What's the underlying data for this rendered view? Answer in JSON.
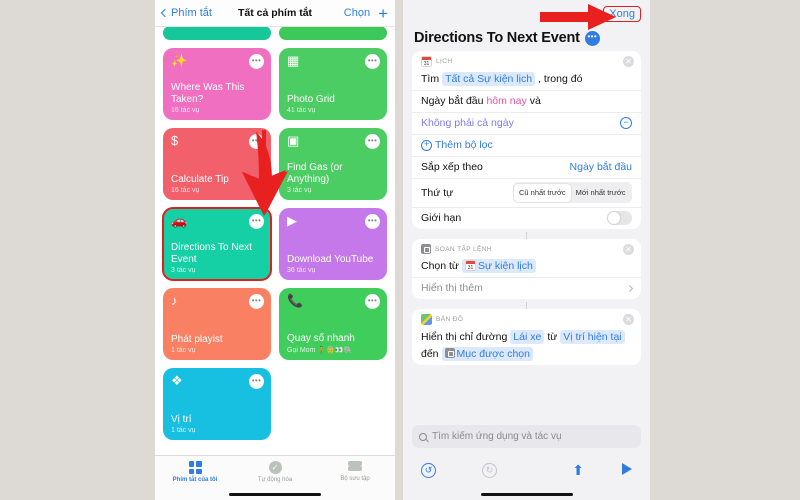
{
  "left_panel": {
    "nav": {
      "back_label": "Phím tắt",
      "title": "Tất cả phím tắt",
      "choose_label": "Chọn",
      "add_label": "+"
    },
    "cards": [
      {
        "title": "",
        "subtitle": "",
        "icon": "",
        "color": "#16c79a",
        "cut": true
      },
      {
        "title": "",
        "subtitle": "",
        "icon": "",
        "color": "#3dc85a",
        "cut": true
      },
      {
        "title": "Where Was This Taken?",
        "subtitle": "16 tác vụ",
        "icon": "✨",
        "color": "#f06fc0",
        "cut": false
      },
      {
        "title": "Photo Grid",
        "subtitle": "41 tác vụ",
        "icon": "▦",
        "color": "#4ccd64",
        "cut": false
      },
      {
        "title": "Calculate Tip",
        "subtitle": "16 tác vụ",
        "icon": "$",
        "color": "#f2606b",
        "cut": false
      },
      {
        "title": "Find Gas (or Anything)",
        "subtitle": "3 tác vụ",
        "icon": "▣",
        "color": "#4ccd64",
        "cut": false
      },
      {
        "title": "Directions To Next Event",
        "subtitle": "3 tác vụ",
        "icon": "🚗",
        "color": "#15cfa5",
        "cut": false,
        "selected": true
      },
      {
        "title": "Download YouTube",
        "subtitle": "36 tác vụ",
        "icon": "▶",
        "color": "#c478ea",
        "cut": false
      },
      {
        "title": "Phát playist",
        "subtitle": "1 tác vụ",
        "icon": "♪",
        "color": "#fa8064",
        "cut": false
      },
      {
        "title": "Quay số nhanh",
        "subtitle": "Gọi Mom 🧍👵👀🐘",
        "icon": "📞",
        "color": "#41cd5c",
        "cut": false
      },
      {
        "title": "Vị trí",
        "subtitle": "1 tác vụ",
        "icon": "❖",
        "color": "#17bfe0",
        "cut": false
      }
    ],
    "tabs": [
      {
        "label": "Phím tắt của tôi",
        "icon": "grid-icon",
        "active": true
      },
      {
        "label": "Tự động hóa",
        "icon": "clock-icon",
        "active": false
      },
      {
        "label": "Bộ sưu tập",
        "icon": "stack-icon",
        "active": false
      }
    ]
  },
  "right_panel": {
    "done_label": "Xong",
    "title": "Directions To Next Event",
    "more_label": "•••",
    "calendar_block": {
      "header": "LỊCH",
      "icon_day": "31",
      "find_prefix": "Tìm",
      "find_token": "Tất cả Sự kiện lịch",
      "find_suffix": ", trong đó",
      "filter1_label": "Ngày bắt đầu",
      "filter1_value": "hôm nay",
      "filter1_suffix": "và",
      "filter2_label": "Không phải cả ngày",
      "add_filter_label": "Thêm bộ lọc",
      "sort_label": "Sắp xếp theo",
      "sort_value": "Ngày bắt đầu",
      "order_label": "Thứ tự",
      "order_option_1": "Cũ nhất trước",
      "order_option_2": "Mới nhất trước",
      "limit_label": "Giới hạn",
      "limit_on": false
    },
    "script_block": {
      "header": "SOẠN TẬP LỆNH",
      "choose_prefix": "Chọn từ",
      "choose_token": "Sự kiện lịch",
      "icon_day": "31",
      "show_more_label": "Hiển thị thêm"
    },
    "maps_block": {
      "header": "BẢN ĐỒ",
      "line_prefix": "Hiển thị chỉ đường",
      "token_mode": "Lái xe",
      "line_mid": "từ",
      "token_from": "Vị trí hiện tại",
      "line_mid2": "đến",
      "token_to": "Mục được chọn"
    },
    "search": {
      "placeholder": "Tìm kiếm ứng dụng và tác vụ"
    },
    "toolbar": {
      "undo_label": "↺",
      "redo_label": "↻",
      "share_label": "⬆",
      "run_label": "play-icon"
    }
  },
  "annotations": {
    "arrow_down_target": "Directions To Next Event",
    "arrow_right_target": "Xong"
  },
  "colors": {
    "accent_blue": "#2f7de0",
    "highlight_red": "#e02020",
    "page_bg": "#ddd9d5"
  }
}
